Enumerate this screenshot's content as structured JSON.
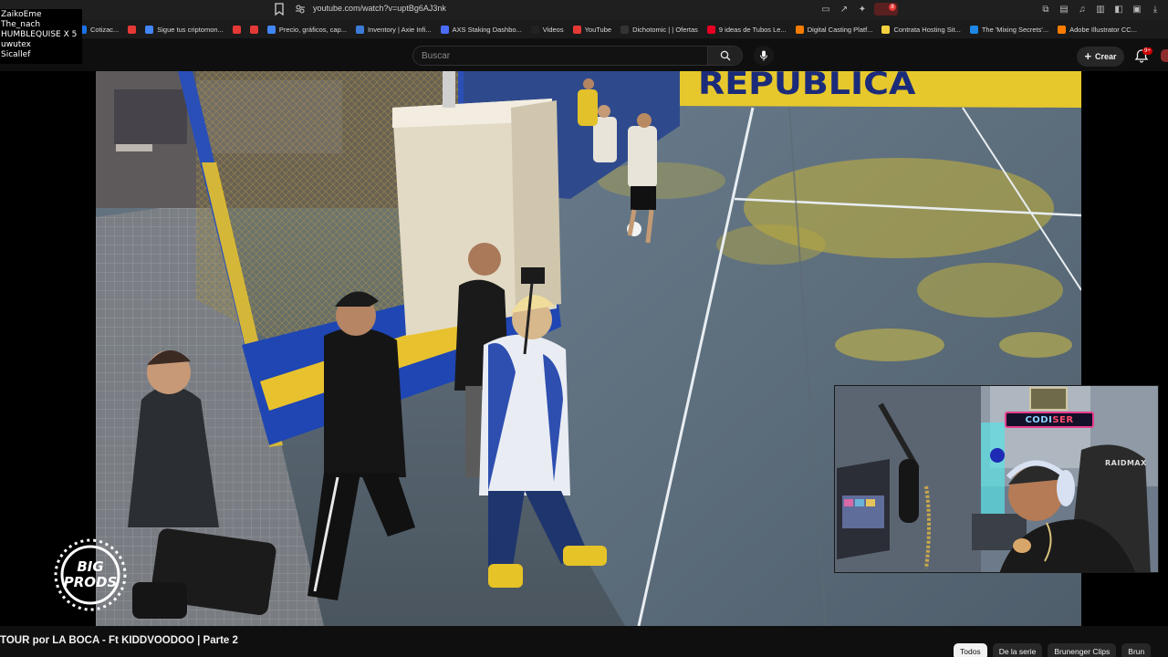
{
  "browser": {
    "url": "youtube.com/watch?v=uptBg6AJ3nk",
    "extension_badge": "8",
    "bookmarks": [
      {
        "label": "Cotizac...",
        "color": "#1a73e8"
      },
      {
        "label": "",
        "color": "#e53935"
      },
      {
        "label": "Sigue tus criptomon...",
        "color": "#4285f4"
      },
      {
        "label": "",
        "color": "#e53935"
      },
      {
        "label": "",
        "color": "#e53935"
      },
      {
        "label": "Precio, gráficos, cap...",
        "color": "#4285f4"
      },
      {
        "label": "Inventory | Axie Infi...",
        "color": "#3d7bd9"
      },
      {
        "label": "AXS Staking Dashbo...",
        "color": "#4a6cf7"
      },
      {
        "label": "Videos",
        "color": "#222222"
      },
      {
        "label": "YouTube",
        "color": "#e53935"
      },
      {
        "label": "Dichotomic | | Ofertas",
        "color": "#333333"
      },
      {
        "label": "9 ideas de Tubos Le...",
        "color": "#e60023"
      },
      {
        "label": "Digital Casting Platf...",
        "color": "#f57c00"
      },
      {
        "label": "Contrata Hosting Sit...",
        "color": "#f4d03f"
      },
      {
        "label": "The 'Mixing Secrets'...",
        "color": "#1e88e5"
      },
      {
        "label": "Adobe Illustrator CC...",
        "color": "#ff7c00"
      }
    ]
  },
  "overlay_names": [
    "ZaikoEme",
    "The_nach",
    "HUMBLEQUISE X 5",
    "uwutex",
    "Sicallef"
  ],
  "header": {
    "search_placeholder": "Buscar",
    "create_label": "Crear",
    "notifications_count": "9+"
  },
  "video": {
    "wall_text": "REPUBLICA",
    "logo_line1": "BIG",
    "logo_line2": "PRODS"
  },
  "webcam": {
    "sign_text_a": "CODI",
    "sign_text_b": "SER",
    "chair_brand": "RAIDMAX"
  },
  "below_video": {
    "title": "TOUR por LA BOCA - Ft KIDDVOODOO | Parte 2",
    "chips": [
      "Todos",
      "De la serie",
      "Brunenger Clips",
      "Brun"
    ]
  }
}
